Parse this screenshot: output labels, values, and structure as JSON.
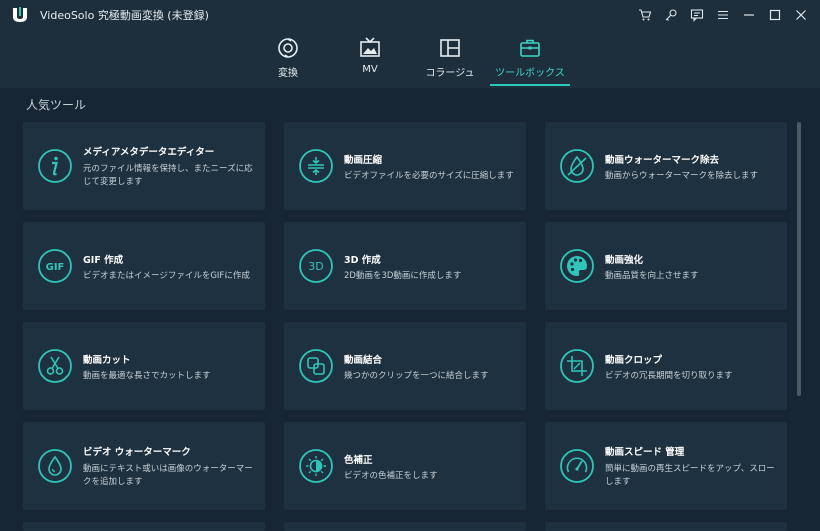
{
  "window": {
    "title": "VideoSolo 究極動画変換 (未登録)"
  },
  "titlebar_icons": [
    "cart-icon",
    "key-icon",
    "chat-icon",
    "menu-icon",
    "minimize-icon",
    "maximize-icon",
    "close-icon"
  ],
  "tabs": [
    {
      "label": "変換",
      "icon": "convert-icon",
      "active": false
    },
    {
      "label": "MV",
      "icon": "mv-icon",
      "active": false
    },
    {
      "label": "コラージュ",
      "icon": "collage-icon",
      "active": false
    },
    {
      "label": "ツールボックス",
      "icon": "toolbox-icon",
      "active": true
    }
  ],
  "section": {
    "title": "人気ツール"
  },
  "tools": [
    {
      "title": "メディアメタデータエディター",
      "desc": "元のファイル情報を保持し、またニーズに応じて変更します",
      "icon": "info-icon"
    },
    {
      "title": "動画圧縮",
      "desc": "ビデオファイルを必要のサイズに圧縮します",
      "icon": "compress-icon"
    },
    {
      "title": "動画ウォーターマーク除去",
      "desc": "動画からウォーターマークを除去します",
      "icon": "watermark-remove-icon"
    },
    {
      "title": "GIF 作成",
      "desc": "ビデオまたはイメージファイルをGIFに作成",
      "icon": "gif-icon"
    },
    {
      "title": "3D 作成",
      "desc": "2D動画を3D動画に作成します",
      "icon": "3d-icon"
    },
    {
      "title": "動画強化",
      "desc": "動画品質を向上させます",
      "icon": "palette-icon"
    },
    {
      "title": "動画カット",
      "desc": "動画を最適な長さでカットします",
      "icon": "scissors-icon"
    },
    {
      "title": "動画結合",
      "desc": "幾つかのクリップを一つに結合します",
      "icon": "merge-icon"
    },
    {
      "title": "動画クロップ",
      "desc": "ビデオの冗長期間を切り取ります",
      "icon": "crop-icon"
    },
    {
      "title": "ビデオ ウォーターマーク",
      "desc": "動画にテキスト或いは画像のウォーターマークを追加します",
      "icon": "watermark-icon"
    },
    {
      "title": "色補正",
      "desc": "ビデオの色補正をします",
      "icon": "color-correct-icon"
    },
    {
      "title": "動画スピード 管理",
      "desc": "簡単に動画の再生スピードをアップ、スローします",
      "icon": "speed-icon"
    }
  ],
  "colors": {
    "accent": "#2fc5b8",
    "background": "#162634",
    "card": "#1e3140",
    "titlebar": "#1d2f3d"
  }
}
